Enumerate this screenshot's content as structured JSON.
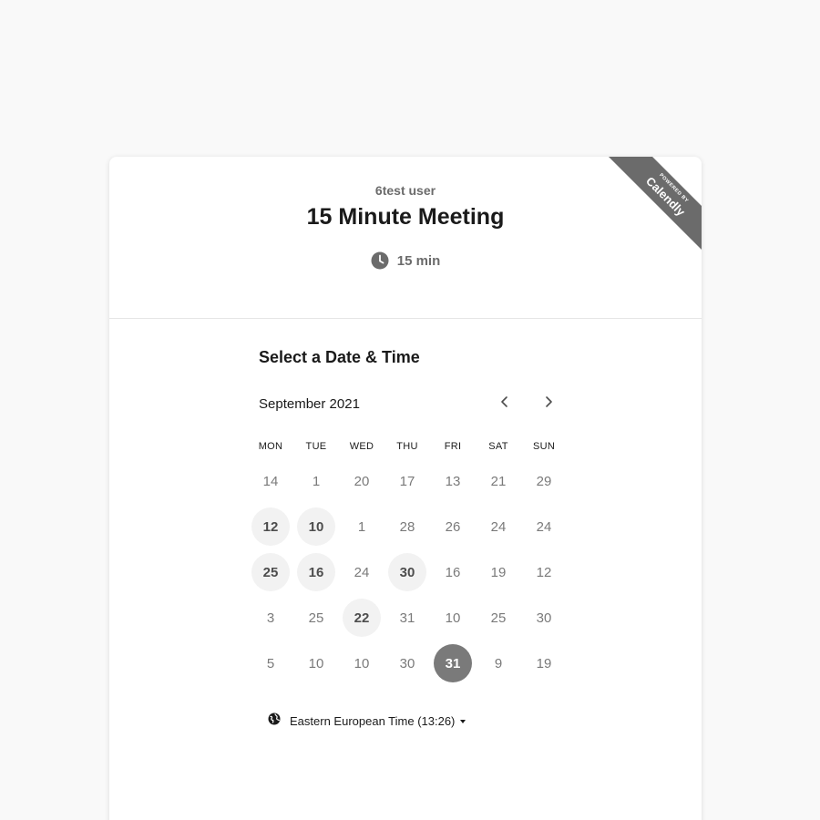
{
  "badge": {
    "powered_by": "POWERED BY",
    "brand": "Calendly"
  },
  "event": {
    "owner": "6test user",
    "title": "15 Minute Meeting",
    "duration": "15 min",
    "duration_icon": "clock-icon"
  },
  "scheduler": {
    "section_title": "Select a Date & Time",
    "month_label": "September 2021",
    "prev_icon": "chevron-left-icon",
    "next_icon": "chevron-right-icon",
    "weekdays": [
      "MON",
      "TUE",
      "WED",
      "THU",
      "FRI",
      "SAT",
      "SUN"
    ],
    "weeks": [
      [
        {
          "n": "14",
          "s": "plain"
        },
        {
          "n": "1",
          "s": "plain"
        },
        {
          "n": "20",
          "s": "plain"
        },
        {
          "n": "17",
          "s": "plain"
        },
        {
          "n": "13",
          "s": "plain"
        },
        {
          "n": "21",
          "s": "plain"
        },
        {
          "n": "29",
          "s": "plain"
        }
      ],
      [
        {
          "n": "12",
          "s": "available"
        },
        {
          "n": "10",
          "s": "available"
        },
        {
          "n": "1",
          "s": "plain"
        },
        {
          "n": "28",
          "s": "plain"
        },
        {
          "n": "26",
          "s": "plain"
        },
        {
          "n": "24",
          "s": "plain"
        },
        {
          "n": "24",
          "s": "plain"
        }
      ],
      [
        {
          "n": "25",
          "s": "available"
        },
        {
          "n": "16",
          "s": "available"
        },
        {
          "n": "24",
          "s": "plain"
        },
        {
          "n": "30",
          "s": "available"
        },
        {
          "n": "16",
          "s": "plain"
        },
        {
          "n": "19",
          "s": "plain"
        },
        {
          "n": "12",
          "s": "plain"
        }
      ],
      [
        {
          "n": "3",
          "s": "plain"
        },
        {
          "n": "25",
          "s": "plain"
        },
        {
          "n": "22",
          "s": "available"
        },
        {
          "n": "31",
          "s": "plain"
        },
        {
          "n": "10",
          "s": "plain"
        },
        {
          "n": "25",
          "s": "plain"
        },
        {
          "n": "30",
          "s": "plain"
        }
      ],
      [
        {
          "n": "5",
          "s": "plain"
        },
        {
          "n": "10",
          "s": "plain"
        },
        {
          "n": "10",
          "s": "plain"
        },
        {
          "n": "30",
          "s": "plain"
        },
        {
          "n": "31",
          "s": "selected"
        },
        {
          "n": "9",
          "s": "plain"
        },
        {
          "n": "19",
          "s": "plain"
        }
      ]
    ],
    "timezone": {
      "label": "Eastern European Time (13:26)",
      "icon": "globe-icon"
    }
  },
  "colors": {
    "page_bg": "#f9f9f9",
    "ribbon": "#6b6b6b",
    "available_bg": "#f2f2f2",
    "selected_bg": "#7a7a7a"
  }
}
